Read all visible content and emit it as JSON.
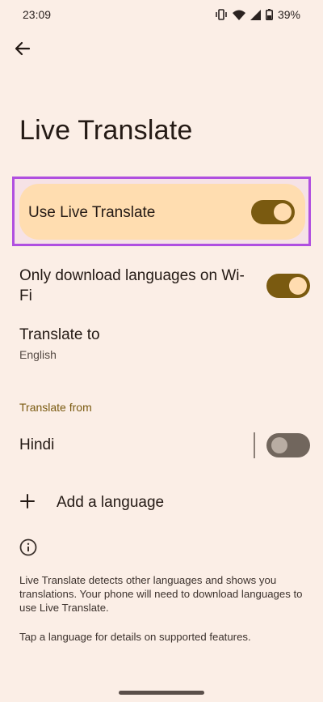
{
  "status_bar": {
    "time": "23:09",
    "battery_percent": "39%",
    "icons": [
      "vibrate-icon",
      "wifi-icon",
      "signal-icon",
      "battery-icon"
    ]
  },
  "header": {
    "back_icon": "back-arrow-icon",
    "title": "Live Translate"
  },
  "main_toggle": {
    "label": "Use Live Translate",
    "on": true
  },
  "settings": {
    "wifi_only": {
      "title": "Only download languages on Wi-Fi",
      "on": true
    },
    "translate_to": {
      "title": "Translate to",
      "value": "English"
    }
  },
  "translate_from": {
    "header": "Translate from",
    "languages": [
      {
        "name": "Hindi",
        "on": false
      }
    ],
    "add_label": "Add a language",
    "add_icon": "plus-icon"
  },
  "info": {
    "icon": "info-icon",
    "text": "Live Translate detects other languages and shows you translations. Your phone will need to download languages to use Live Translate.",
    "tip": "Tap a language for details on supported features."
  },
  "colors": {
    "background": "#fbeee6",
    "card": "#ffddb0",
    "accent": "#7a5a10",
    "highlight_border": "#b04fe0"
  }
}
